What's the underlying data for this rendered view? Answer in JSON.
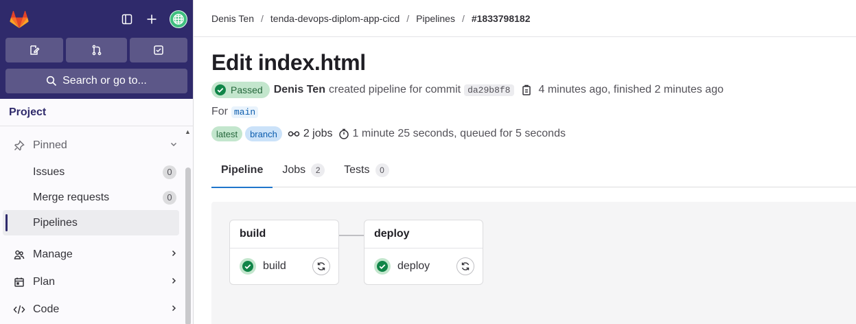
{
  "sidebar": {
    "search_label": "Search or go to...",
    "section_title": "Project",
    "pinned_label": "Pinned",
    "pinned_items": [
      {
        "label": "Issues",
        "count": "0"
      },
      {
        "label": "Merge requests",
        "count": "0"
      },
      {
        "label": "Pipelines"
      }
    ],
    "nav_items": [
      {
        "label": "Manage"
      },
      {
        "label": "Plan"
      },
      {
        "label": "Code"
      }
    ]
  },
  "breadcrumb": [
    "Denis Ten",
    "tenda-devops-diplom-app-cicd",
    "Pipelines",
    "#1833798182"
  ],
  "pipeline": {
    "title": "Edit index.html",
    "status": "Passed",
    "author": "Denis Ten",
    "created_text": "created pipeline for commit",
    "commit_sha": "da29b8f8",
    "time_text": "4 minutes ago, finished 2 minutes ago",
    "for_label": "For",
    "branch": "main",
    "tags": [
      "latest",
      "branch"
    ],
    "jobs_text": "2 jobs",
    "duration_text": "1 minute 25 seconds, queued for 5 seconds"
  },
  "tabs": [
    {
      "label": "Pipeline"
    },
    {
      "label": "Jobs",
      "count": "2"
    },
    {
      "label": "Tests",
      "count": "0"
    }
  ],
  "stages": [
    {
      "name": "build",
      "job": "build"
    },
    {
      "name": "deploy",
      "job": "deploy"
    }
  ],
  "colors": {
    "sidebar_top": "#2f2a6b",
    "success": "#108548",
    "tab_underline": "#1f75cb"
  }
}
